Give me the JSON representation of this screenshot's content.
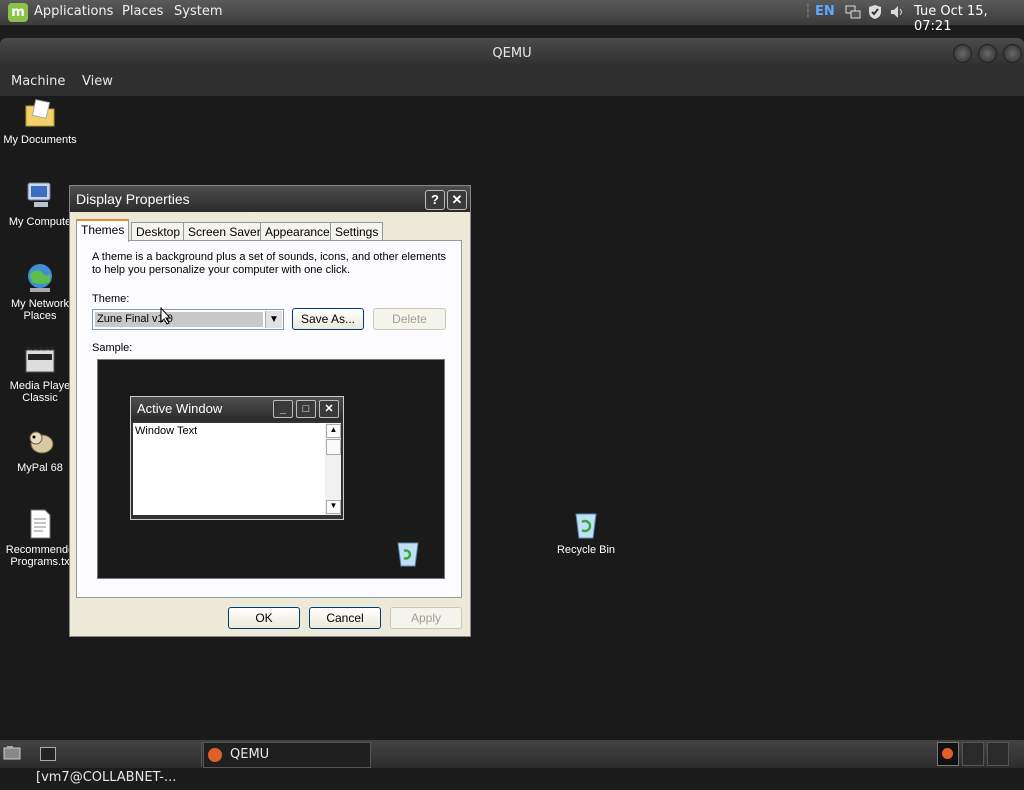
{
  "topbar": {
    "menus": [
      "Applications",
      "Places",
      "System"
    ],
    "lang": "EN",
    "clock": "Tue Oct 15, 07:21"
  },
  "qemu": {
    "title": "QEMU",
    "menus": [
      "Machine",
      "View"
    ]
  },
  "desktop_icons": [
    {
      "label": "My Documents",
      "icon": "folder-documents-icon"
    },
    {
      "label": "My Compute",
      "icon": "computer-icon"
    },
    {
      "label": "My Network Places",
      "icon": "network-places-icon"
    },
    {
      "label": "Media Playe Classic",
      "icon": "media-player-icon"
    },
    {
      "label": "MyPal 68",
      "icon": "mypal-icon"
    },
    {
      "label": "Recommende Programs.tx",
      "icon": "text-file-icon"
    },
    {
      "label": "Recycle Bin",
      "icon": "recycle-bin-icon"
    }
  ],
  "dialog": {
    "title": "Display Properties",
    "help": "?",
    "close": "✕",
    "tabs": [
      "Themes",
      "Desktop",
      "Screen Saver",
      "Appearance",
      "Settings"
    ],
    "description": "A theme is a background plus a set of sounds, icons, and other elements to help you personalize your computer with one click.",
    "theme_label": "Theme:",
    "theme_value": "Zune Final v1.0",
    "save_as": "Save As...",
    "delete": "Delete",
    "sample_label": "Sample:",
    "sample_window_title": "Active Window",
    "sample_window_text": "Window Text",
    "ok": "OK",
    "cancel": "Cancel",
    "apply": "Apply"
  },
  "taskbar": {
    "tasks": [
      "[vm7@COLLABNET-...",
      "QEMU"
    ]
  },
  "colors": {
    "tab_highlight": "#e68b2c",
    "button_border": "#003c74",
    "mint_green": "#8bc34a"
  }
}
